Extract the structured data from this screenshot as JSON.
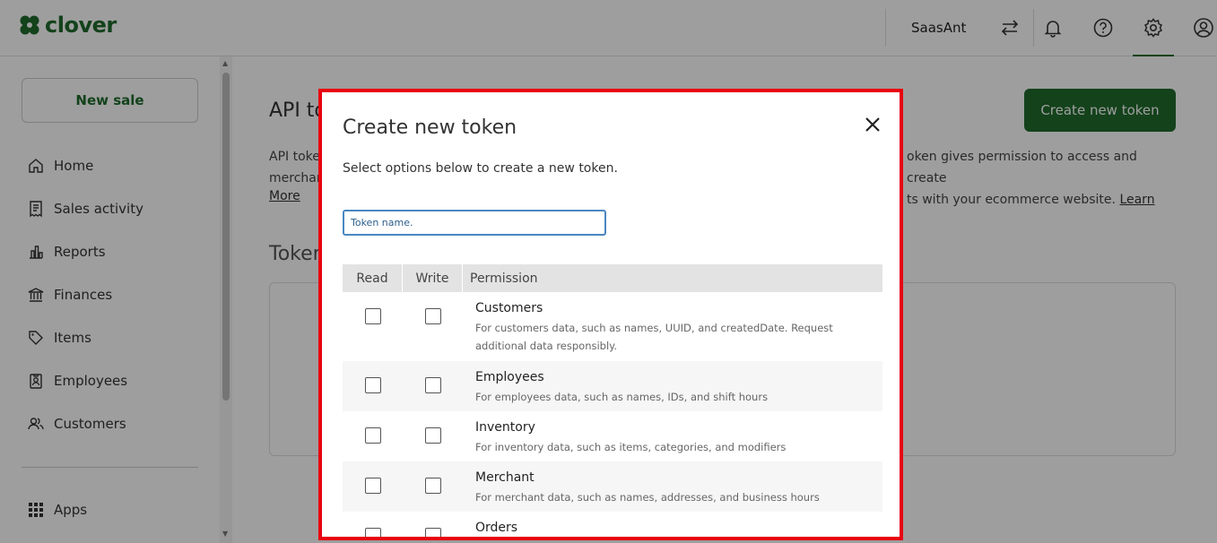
{
  "header": {
    "logo_text": "clover",
    "merchant_name": "SaasAnt",
    "icons": [
      "switch-arrows-icon",
      "bell-icon",
      "help-icon",
      "gear-icon",
      "account-icon"
    ]
  },
  "sidebar": {
    "new_sale_label": "New sale",
    "items": [
      {
        "label": "Home",
        "icon": "home-icon"
      },
      {
        "label": "Sales activity",
        "icon": "receipt-icon"
      },
      {
        "label": "Reports",
        "icon": "bar-chart-icon"
      },
      {
        "label": "Finances",
        "icon": "bank-icon"
      },
      {
        "label": "Items",
        "icon": "tag-icon"
      },
      {
        "label": "Employees",
        "icon": "badge-icon"
      },
      {
        "label": "Customers",
        "icon": "people-icon"
      }
    ],
    "apps_label": "Apps"
  },
  "main": {
    "title_partial": "API to",
    "desc_left_1": "API toke",
    "desc_left_2": "merchar",
    "desc_right_1": "oken gives permission to access and create",
    "desc_right_2": "ts with your ecommerce website.",
    "learn_label": "Learn",
    "more_label": "More",
    "tokens_heading_partial": "Token",
    "create_button_label": "Create new token"
  },
  "modal": {
    "title": "Create new token",
    "subtitle": "Select options below to create a new token.",
    "input_placeholder": "Token name.",
    "table_headers": {
      "read": "Read",
      "write": "Write",
      "permission": "Permission"
    },
    "permissions": [
      {
        "name": "Customers",
        "description": "For customers data, such as names, UUID, and createdDate. Request additional data responsibly."
      },
      {
        "name": "Employees",
        "description": "For employees data, such as names, IDs, and shift hours"
      },
      {
        "name": "Inventory",
        "description": "For inventory data, such as items, categories, and modifiers"
      },
      {
        "name": "Merchant",
        "description": "For merchant data, such as names, addresses, and business hours"
      },
      {
        "name": "Orders",
        "description": ""
      }
    ]
  },
  "colors": {
    "brand_green": "#1f6b2c",
    "highlight_red": "#e8000f"
  }
}
